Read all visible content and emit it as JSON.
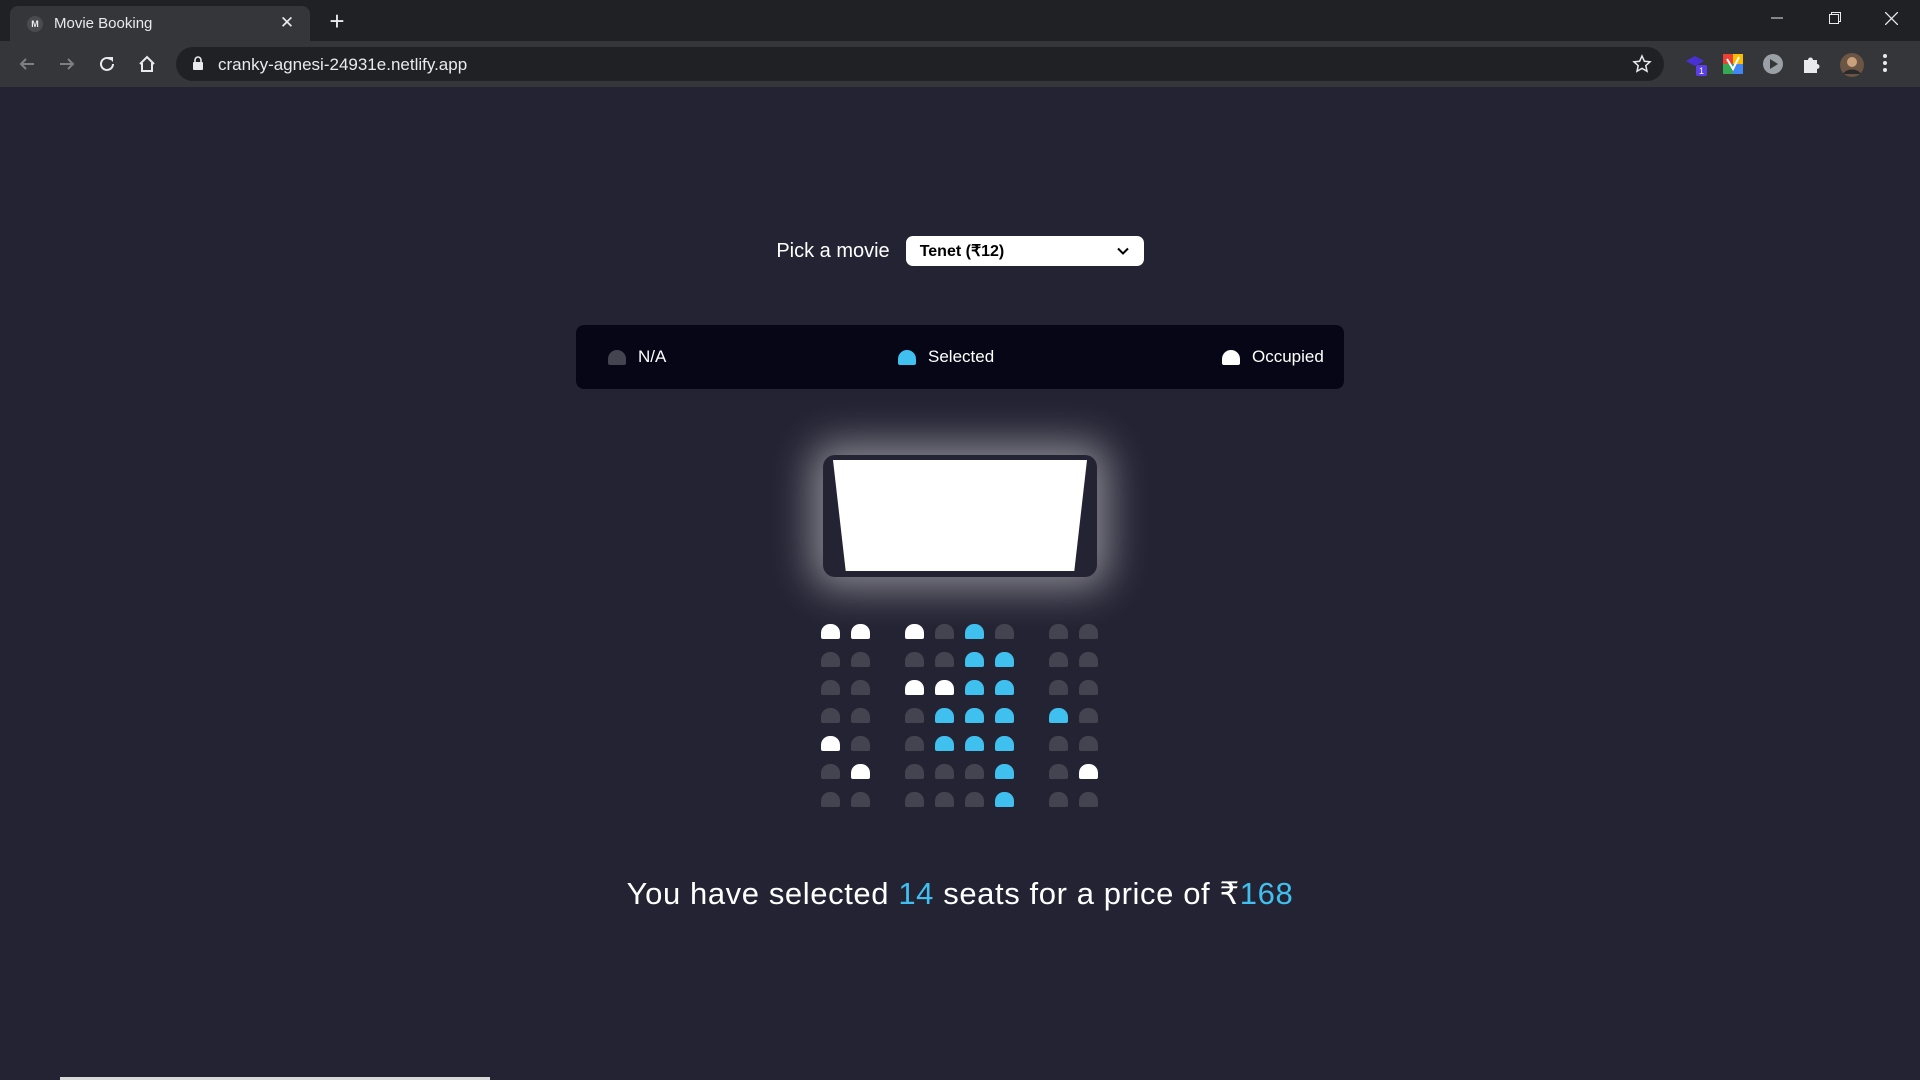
{
  "browser": {
    "tab_title": "Movie Booking",
    "tab_favicon_letter": "M",
    "url": "cranky-agnesi-24931e.netlify.app",
    "extension_badge": "1"
  },
  "picker": {
    "label": "Pick a movie",
    "selected": "Tenet (₹12)"
  },
  "legend": [
    {
      "label": "N/A",
      "state": "na"
    },
    {
      "label": "Selected",
      "state": "selected"
    },
    {
      "label": "Occupied",
      "state": "occupied"
    }
  ],
  "colors": {
    "background": "#242333",
    "seat_na": "#444451",
    "seat_selected": "#3fc0ee",
    "seat_occupied": "#ffffff"
  },
  "seats": [
    [
      "O",
      "O",
      "O",
      "N",
      "S",
      "N",
      "N",
      "N"
    ],
    [
      "N",
      "N",
      "N",
      "N",
      "S",
      "S",
      "N",
      "N"
    ],
    [
      "N",
      "N",
      "O",
      "O",
      "S",
      "S",
      "N",
      "N"
    ],
    [
      "N",
      "N",
      "N",
      "S",
      "S",
      "S",
      "S",
      "N"
    ],
    [
      "O",
      "N",
      "N",
      "S",
      "S",
      "S",
      "N",
      "N"
    ],
    [
      "N",
      "O",
      "N",
      "N",
      "N",
      "S",
      "N",
      "O"
    ],
    [
      "N",
      "N",
      "N",
      "N",
      "N",
      "S",
      "N",
      "N"
    ]
  ],
  "summary": {
    "prefix": "You have selected",
    "count": "14",
    "middle": "seats for a price of",
    "currency": "₹",
    "price": "168"
  }
}
